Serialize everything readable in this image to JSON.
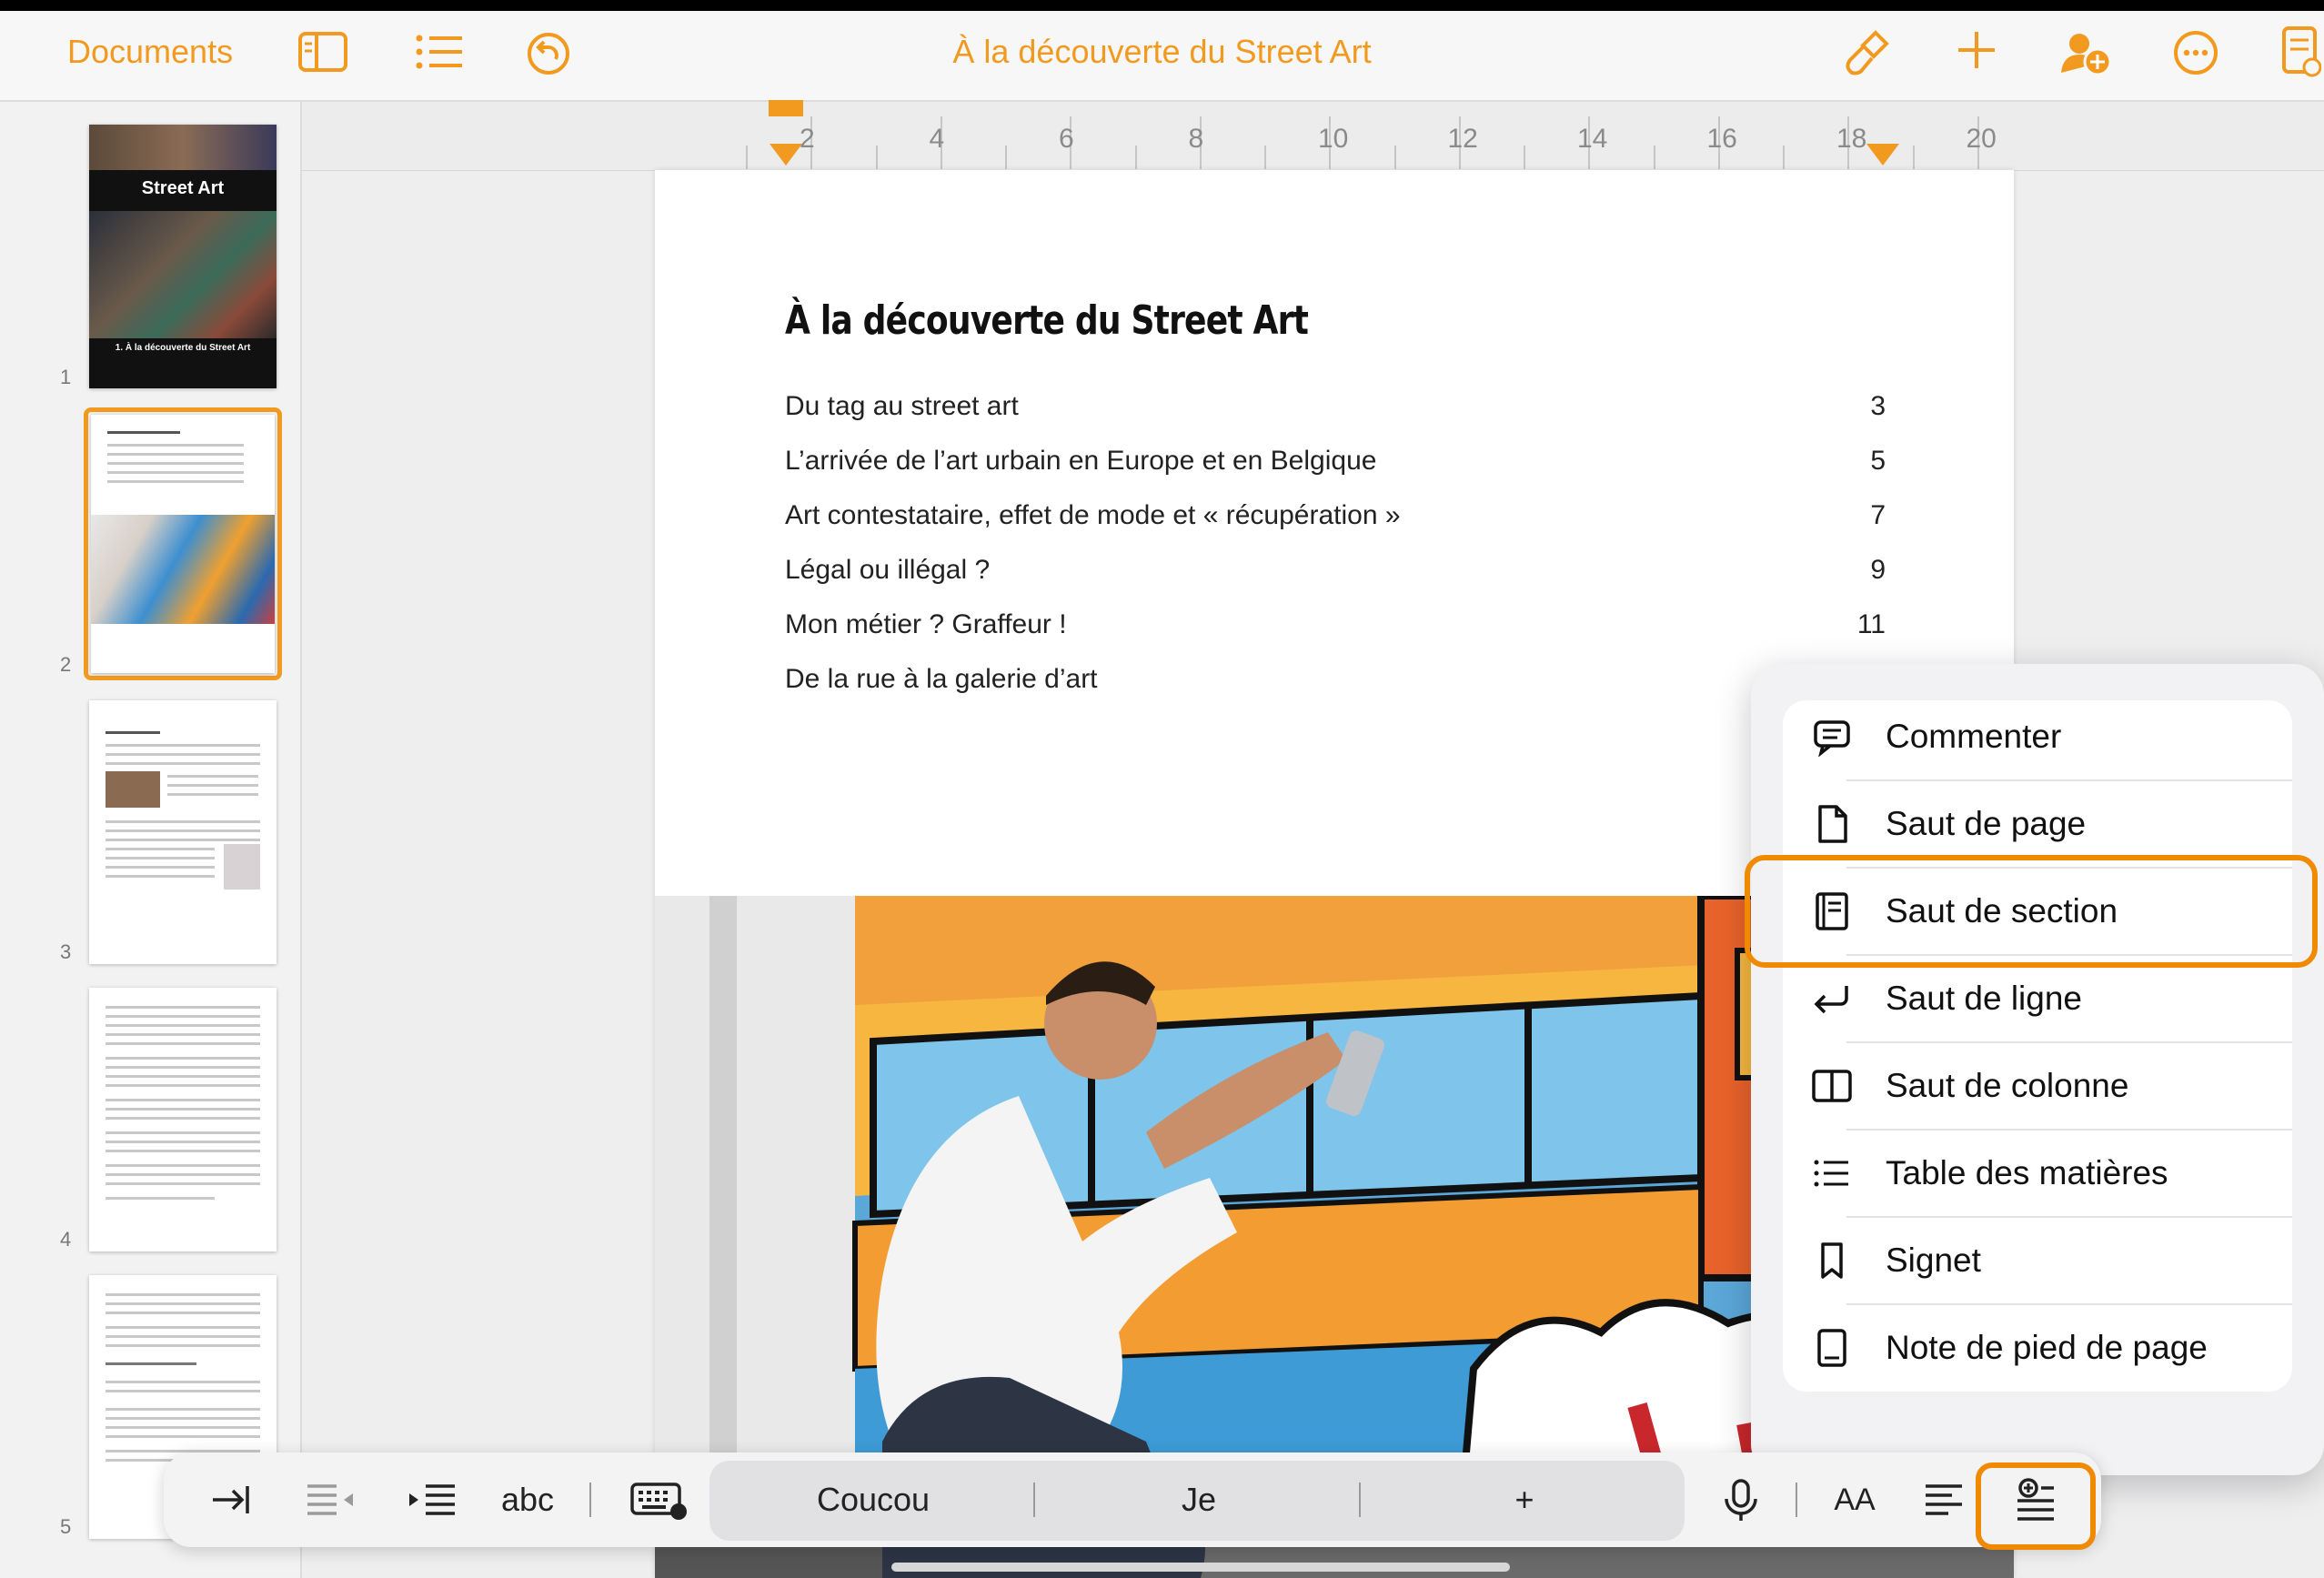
{
  "topbar": {
    "back_label": "Documents",
    "title": "À la découverte du Street Art"
  },
  "sidebar": {
    "pages": [
      {
        "number": "1",
        "cover_title": "Street Art",
        "cover_subtitle": "1. À la découverte du Street Art"
      },
      {
        "number": "2"
      },
      {
        "number": "3"
      },
      {
        "number": "4"
      },
      {
        "number": "5"
      }
    ]
  },
  "ruler": {
    "labels": [
      "2",
      "4",
      "6",
      "8",
      "10",
      "12",
      "14",
      "16",
      "18",
      "20"
    ]
  },
  "document": {
    "title": "À la découverte du Street Art",
    "toc": [
      {
        "text": "Du tag au street art",
        "page": "3"
      },
      {
        "text": "L’arrivée de l’art urbain en Europe et en Belgique",
        "page": "5"
      },
      {
        "text": "Art contestataire, effet de mode et « récupération »",
        "page": "7"
      },
      {
        "text": "Légal ou illégal ?",
        "page": "9"
      },
      {
        "text": "Mon métier ? Graffeur !",
        "page": "11"
      },
      {
        "text": "De la rue à la galerie d’art",
        "page": ""
      }
    ]
  },
  "insert_menu": {
    "items": [
      {
        "label": "Commenter",
        "icon": "comment-icon"
      },
      {
        "label": "Saut de page",
        "icon": "page-icon"
      },
      {
        "label": "Saut de section",
        "icon": "section-icon",
        "highlighted": true
      },
      {
        "label": "Saut de ligne",
        "icon": "return-icon"
      },
      {
        "label": "Saut de colonne",
        "icon": "columns-icon"
      },
      {
        "label": "Table des matières",
        "icon": "list-icon"
      },
      {
        "label": "Signet",
        "icon": "bookmark-icon"
      },
      {
        "label": "Note de pied de page",
        "icon": "footnote-icon"
      }
    ]
  },
  "bottom_toolbar": {
    "spelling_label": "abc",
    "suggestions": [
      "Coucou",
      "Je",
      "+"
    ],
    "text_size_label": "AA"
  },
  "colors": {
    "accent": "#f19a1f",
    "highlight": "#f08a00"
  }
}
